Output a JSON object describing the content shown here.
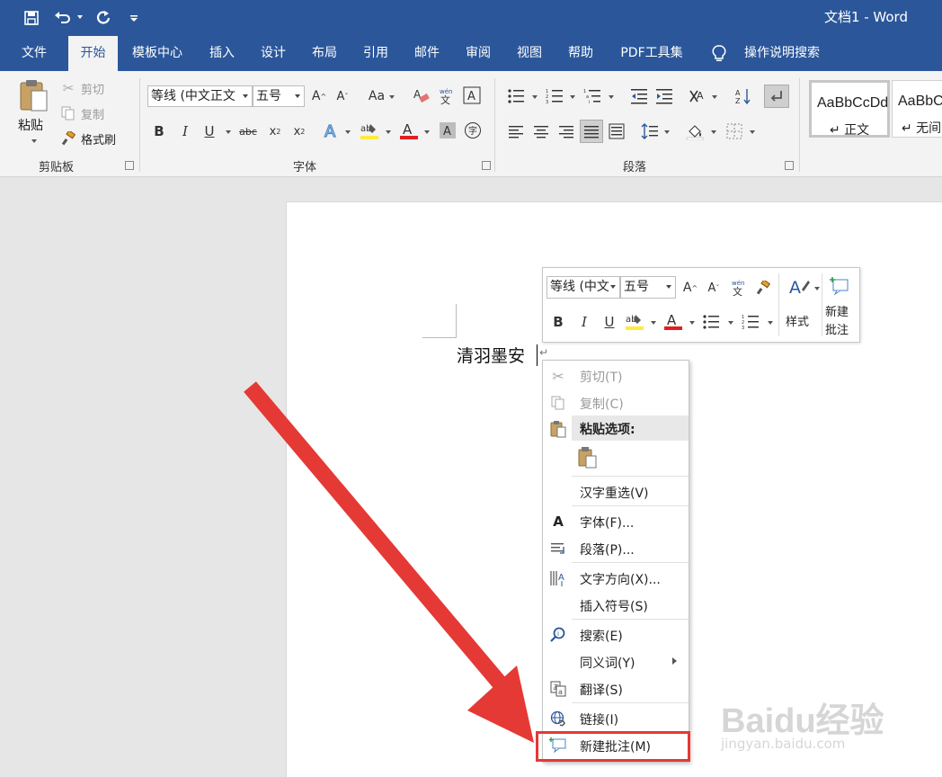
{
  "titlebar": {
    "title": "文档1  -  Word",
    "icons": [
      "save-icon",
      "undo-icon",
      "redo-icon",
      "customize-qat-icon"
    ]
  },
  "tabs": [
    {
      "label": "文件"
    },
    {
      "label": "开始"
    },
    {
      "label": "模板中心"
    },
    {
      "label": "插入"
    },
    {
      "label": "设计"
    },
    {
      "label": "布局"
    },
    {
      "label": "引用"
    },
    {
      "label": "邮件"
    },
    {
      "label": "审阅"
    },
    {
      "label": "视图"
    },
    {
      "label": "帮助"
    },
    {
      "label": "PDF工具集"
    },
    {
      "label": "操作说明搜索"
    }
  ],
  "ribbon": {
    "clipboard": {
      "paste_label": "粘贴",
      "cut_label": "剪切",
      "copy_label": "复制",
      "format_painter_label": "格式刷",
      "group_label": "剪贴板"
    },
    "font": {
      "font_name": "等线 (中文正文",
      "font_size": "五号",
      "group_label": "字体"
    },
    "paragraph": {
      "group_label": "段落"
    },
    "styles": {
      "items": [
        {
          "preview": "AaBbCcDd",
          "name": "↵ 正文"
        },
        {
          "preview": "AaBbC",
          "name": "↵ 无间"
        }
      ]
    }
  },
  "document": {
    "text": "清羽墨安"
  },
  "mini_toolbar": {
    "font_name": "等线 (中文",
    "font_size": "五号",
    "styles_label": "样式",
    "new_comment_label_1": "新建",
    "new_comment_label_2": "批注"
  },
  "context_menu": {
    "items": [
      {
        "label": "剪切(T)"
      },
      {
        "label": "复制(C)"
      },
      {
        "label": "粘贴选项:"
      },
      {
        "label": "汉字重选(V)"
      },
      {
        "label": "字体(F)..."
      },
      {
        "label": "段落(P)..."
      },
      {
        "label": "文字方向(X)..."
      },
      {
        "label": "插入符号(S)"
      },
      {
        "label": "搜索(E)"
      },
      {
        "label": "同义词(Y)"
      },
      {
        "label": "翻译(S)"
      },
      {
        "label": "链接(I)"
      },
      {
        "label": "新建批注(M)"
      }
    ]
  },
  "watermark": {
    "brand": "Baidu经验",
    "url": "jingyan.baidu.com"
  },
  "colors": {
    "brand_blue": "#2b579a",
    "arrow_red": "#e53935",
    "highlight_yellow": "#ffeb3b",
    "font_color_red": "#e02020"
  }
}
